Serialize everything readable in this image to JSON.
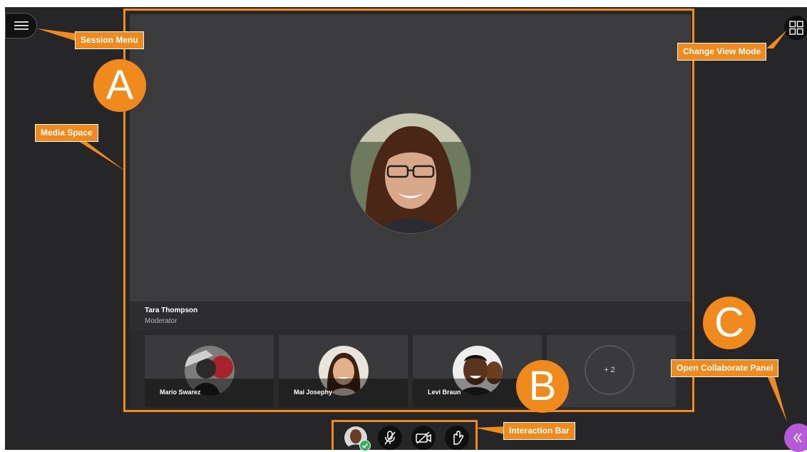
{
  "presenter": {
    "name": "Tara Thompson",
    "role": "Moderator"
  },
  "participants": [
    {
      "name": "Mario Swarez"
    },
    {
      "name": "Mai Josephy"
    },
    {
      "name": "Levi Braun"
    }
  ],
  "overflow_count": "+ 2",
  "callouts": {
    "session_menu": "Session Menu",
    "change_view_mode": "Change View Mode",
    "media_space": "Media Space",
    "interaction_bar": "Interaction Bar",
    "open_collaborate_panel": "Open Collaborate Panel"
  },
  "markers": {
    "a": "A",
    "b": "B",
    "c": "C"
  },
  "icons": {
    "session_menu": "hamburger-icon",
    "view_mode": "grid-icon",
    "mic": "microphone-muted-icon",
    "camera": "camera-off-icon",
    "hand": "raise-hand-icon",
    "collab": "chevron-double-left-icon"
  },
  "colors": {
    "accent": "#f08a1c",
    "collab_button": "#b65bd7",
    "background": "#262628",
    "status_ok": "#2db35a"
  }
}
